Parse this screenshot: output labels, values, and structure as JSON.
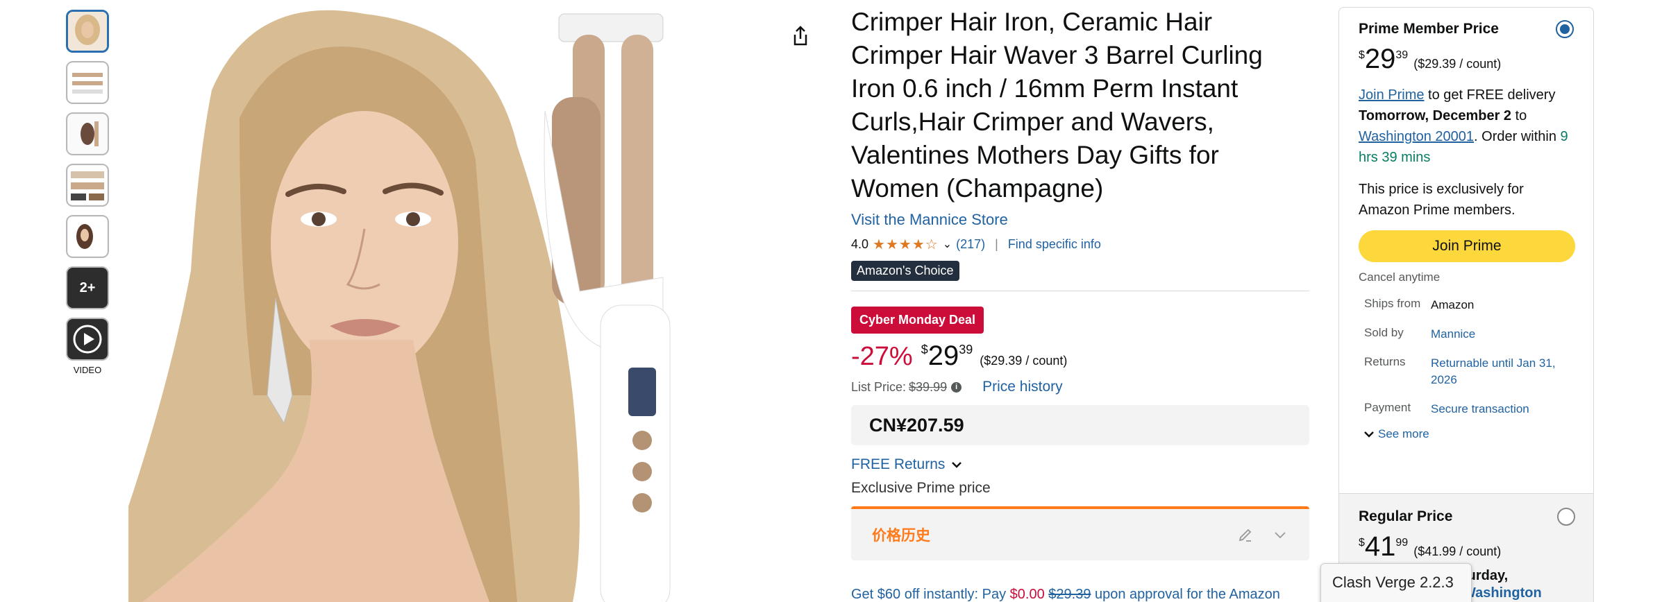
{
  "thumbnails": {
    "more_label": "2+",
    "video_label": "VIDEO"
  },
  "product": {
    "title": "Crimper Hair Iron, Ceramic Hair Crimper Hair Waver 3 Barrel Curling Iron 0.6 inch / 16mm Perm Instant Curls,Hair Crimper and Wavers, Valentines Mothers Day Gifts for Women (Champagne)",
    "store_link": "Visit the Mannice Store",
    "rating": "4.0",
    "stars": "★★★★☆",
    "rating_count": "(217)",
    "find_info": "Find specific info",
    "badge": "Amazon's Choice"
  },
  "pricing": {
    "deal_badge": "Cyber Monday Deal",
    "discount": "-27%",
    "currency": "$",
    "whole": "29",
    "fraction": "39",
    "per_count": "($29.39 / count)",
    "list_price_label": "List Price:",
    "list_price": "$39.99",
    "price_history_link": "Price history",
    "cny_price": "CN¥207.59",
    "free_returns": "FREE Returns",
    "exclusive": "Exclusive Prime price",
    "price_history_cn": "价格历史"
  },
  "offer": {
    "part1": "Get $60 off instantly: Pay ",
    "pay": "$0.00",
    "space": " ",
    "strike": "$29.39",
    "part2": " upon approval for the Amazon Store Card. No annual fee."
  },
  "buybox": {
    "prime_title": "Prime Member Price",
    "currency": "$",
    "whole": "29",
    "fraction": "39",
    "per_count": "($29.39 / count)",
    "join_prime_link": "Join Prime",
    "delivery_text1": " to get FREE delivery ",
    "delivery_date": "Tomorrow, December 2",
    "delivery_text2": " to ",
    "location": "Washington 20001",
    "delivery_text3": ". Order within ",
    "countdown": "9 hrs 39 mins",
    "exclusive_note": "This price is exclusively for Amazon Prime members.",
    "join_button": "Join Prime",
    "cancel": "Cancel anytime",
    "ships_from_label": "Ships from",
    "ships_from": "Amazon",
    "sold_by_label": "Sold by",
    "sold_by": "Mannice",
    "returns_label": "Returns",
    "returns": "Returnable until Jan 31, 2026",
    "payment_label": "Payment",
    "payment": "Secure transaction",
    "see_more": "See more",
    "regular_title": "Regular Price",
    "reg_whole": "41",
    "reg_fraction": "99",
    "reg_per_count": "($41.99 / count)",
    "reg_partial": "turday,",
    "reg_partial2": "Washington"
  },
  "tooltip": {
    "text": "Clash Verge 2.2.3"
  },
  "colors": {
    "link": "#2162a1",
    "deal": "#cc0c39",
    "prime_button": "#fcd83d",
    "orange": "#ff7a1a"
  }
}
